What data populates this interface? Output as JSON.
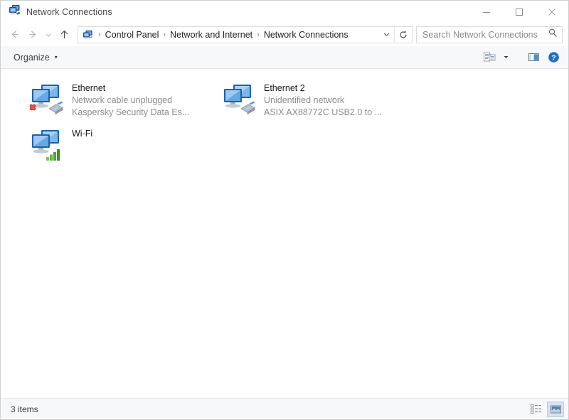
{
  "window": {
    "title": "Network Connections",
    "title_icon": "network-connections-icon",
    "minimize_label": "Minimize",
    "maximize_label": "Maximize",
    "close_label": "Close"
  },
  "nav": {
    "back_label": "Back",
    "forward_label": "Forward",
    "recent_label": "Recent locations",
    "up_label": "Up",
    "breadcrumbs": [
      {
        "label": "Control Panel"
      },
      {
        "label": "Network and Internet"
      },
      {
        "label": "Network Connections"
      }
    ],
    "separator": "›",
    "chevron_label": "Previous locations",
    "refresh_label": "Refresh"
  },
  "search": {
    "placeholder": "Search Network Connections",
    "value": "",
    "icon": "search-icon"
  },
  "toolbar": {
    "organize_label": "Organize",
    "organize_caret": "▾",
    "view_options_label": "Change your view",
    "preview_pane_label": "Show the preview pane",
    "help_label": "Help"
  },
  "connections": [
    {
      "name": "Ethernet",
      "status": "Network cable unplugged",
      "device": "Kaspersky Security Data Es...",
      "icon": "network-adapter-icon",
      "overlay": "red-x-overlay"
    },
    {
      "name": "Ethernet 2",
      "status": "Unidentified network",
      "device": "ASIX AX88772C USB2.0 to ...",
      "icon": "network-adapter-icon",
      "overlay": "none"
    },
    {
      "name": "Wi-Fi",
      "status": "",
      "device": "",
      "icon": "network-adapter-icon",
      "overlay": "signal-bars-overlay"
    }
  ],
  "status": {
    "items_text": "3 items",
    "details_view_label": "Details view",
    "large_icons_view_label": "Large icons view"
  },
  "colors": {
    "accent": "#1f6fc4",
    "toolbar_bg": "#f7f8fa",
    "content_bg": "#ffffff",
    "subtitle": "#8d8d8d",
    "red_x": "#d93025",
    "signal_green": "#4aa832"
  }
}
